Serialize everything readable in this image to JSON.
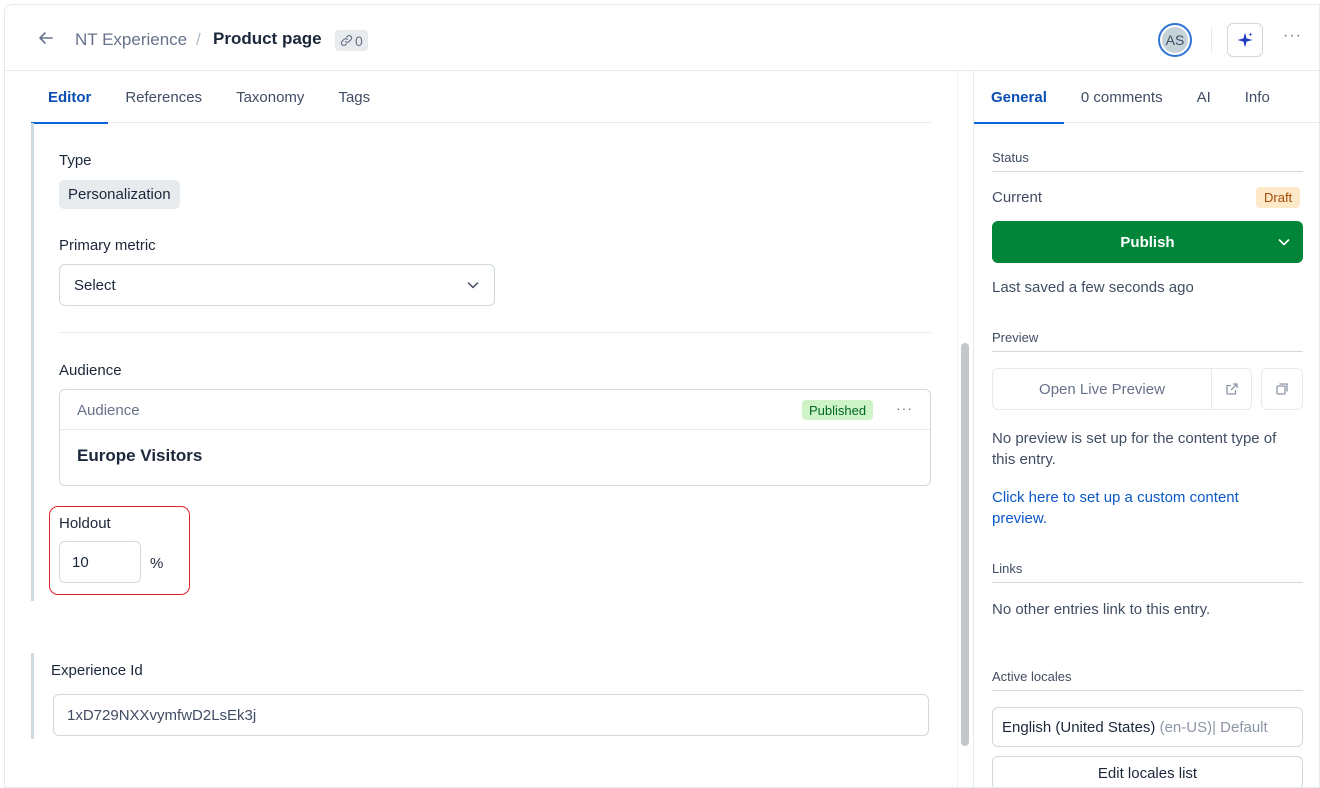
{
  "header": {
    "breadcrumb_parent": "NT Experience",
    "breadcrumb_separator": "/",
    "title": "Product page",
    "references_count": "0",
    "avatar_initials": "AS",
    "more_label": "···"
  },
  "editor_tabs": [
    {
      "label": "Editor",
      "active": true
    },
    {
      "label": "References",
      "active": false
    },
    {
      "label": "Taxonomy",
      "active": false
    },
    {
      "label": "Tags",
      "active": false
    }
  ],
  "fields": {
    "type_label": "Type",
    "type_value": "Personalization",
    "primary_metric_label": "Primary metric",
    "primary_metric_value": "Select",
    "audience_label": "Audience",
    "audience_card_title": "Audience",
    "audience_status": "Published",
    "audience_more": "···",
    "audience_value": "Europe Visitors",
    "holdout_label": "Holdout",
    "holdout_value": "10",
    "holdout_unit": "%",
    "experience_id_label": "Experience Id",
    "experience_id_value": "1xD729NXXvymfwD2LsEk3j"
  },
  "sidebar_tabs": [
    {
      "label": "General",
      "active": true
    },
    {
      "label": "0 comments",
      "active": false
    },
    {
      "label": "AI",
      "active": false
    },
    {
      "label": "Info",
      "active": false
    }
  ],
  "sidebar": {
    "status_heading": "Status",
    "current_label": "Current",
    "current_status": "Draft",
    "publish_label": "Publish",
    "last_saved": "Last saved a few seconds ago",
    "preview_heading": "Preview",
    "open_live_preview": "Open Live Preview",
    "no_preview_text": "No preview is set up for the content type of this entry.",
    "setup_link": "Click here to set up a custom content preview.",
    "links_heading": "Links",
    "links_text": "No other entries link to this entry.",
    "locales_heading": "Active locales",
    "locale_name": "English (United States)",
    "locale_suffix": "(en-US)| Default",
    "edit_locales_label": "Edit locales list"
  },
  "colors": {
    "accent": "#0b64d6",
    "publish": "#008539",
    "highlight_outline": "#e0202e",
    "published_badge": "#cdf3c6",
    "draft_badge": "#fde8c8"
  }
}
